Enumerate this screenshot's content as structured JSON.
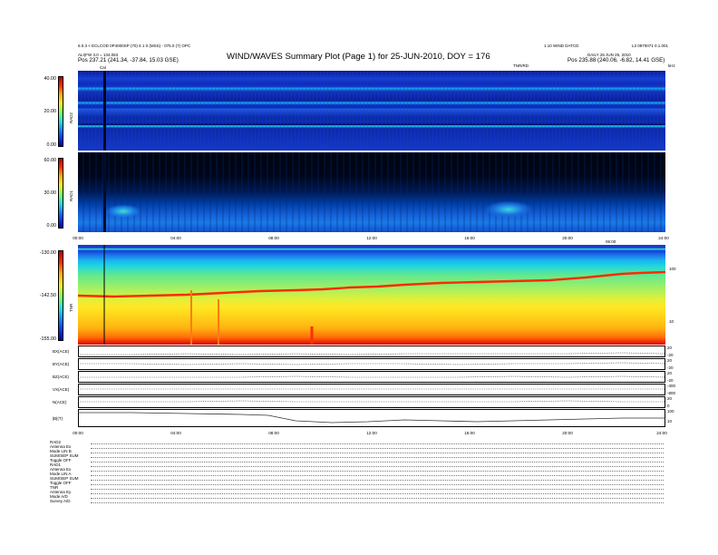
{
  "header": {
    "title": "WIND/WAVES Summary Plot (Page 1) for 25-JUN-2010, DOY = 176",
    "left_line1": "6.0.3 < ECLCOD 0P4000SP (70) 6 1 0 (MSS) - 075.0 (7) OPC",
    "left_line2": "ALI(FW 3.0 = 134.063",
    "left_line3": "Pos    237.21 (241.34, -37.84, 15.03 GSE)",
    "cal_label": "Cal",
    "right_line1": "1.10 WIND DATCD",
    "right_line2": "L3 0970071 0.1.001",
    "right_line3": "DAILY 25 JUN 25, 2010",
    "right_line4": "Pos    235.88 (240.06, -6.82, 14.41 GSE)",
    "tnr_label": "TNR/RD",
    "unit_label": "kHz"
  },
  "colorbar_labels": {
    "rad2": "RAD2",
    "rad1": "RAD1",
    "tnr": "TNR"
  },
  "chart_data": [
    {
      "type": "heatmap",
      "name": "RAD2",
      "yticks": [
        "40.00",
        "20.00",
        "0.00"
      ],
      "ylim": [
        0,
        40
      ]
    },
    {
      "type": "heatmap",
      "name": "RAD1",
      "yticks": [
        "60.00",
        "30.00",
        "0.00"
      ],
      "ylim": [
        0,
        60
      ],
      "xticks": [
        "00:00",
        "04:00",
        "08:00",
        "12:00",
        "16:00",
        "20:00",
        "24:00"
      ],
      "xtick_right_label": "06:00"
    },
    {
      "type": "heatmap",
      "name": "TNR",
      "yticks": [
        "-130.00",
        "-142.50",
        "-155.00"
      ],
      "ylim": [
        -155,
        -130
      ],
      "right_ticks": [
        "100",
        "10"
      ]
    },
    {
      "type": "line",
      "panels": [
        {
          "label": "BX(ACE)",
          "right_ticks": [
            "20",
            "-20"
          ]
        },
        {
          "label": "BY(ACE)",
          "right_ticks": [
            "20",
            "-20"
          ]
        },
        {
          "label": "BZ(ACE)",
          "right_ticks": [
            "20",
            "-20"
          ]
        },
        {
          "label": "VX(ACE)",
          "right_ticks": [
            "-300",
            "-800"
          ]
        },
        {
          "label": "N(ACE)",
          "right_ticks": [
            "20",
            "0"
          ]
        },
        {
          "label": "|B|(T)",
          "right_ticks": [
            "100",
            "10"
          ]
        }
      ],
      "xticks": [
        "00:00",
        "04:00",
        "08:00",
        "12:00",
        "16:00",
        "20:00",
        "24:00"
      ]
    }
  ],
  "footer": [
    {
      "label": "RAD2",
      "value": ""
    },
    {
      "label": "Antenna",
      "value": "Ex"
    },
    {
      "label": "Mode",
      "value": "LIN B"
    },
    {
      "label": "SUM/SEP",
      "value": "SUM"
    },
    {
      "label": "Toggle",
      "value": "OFF"
    },
    {
      "label": "RAD1",
      "value": ""
    },
    {
      "label": "Antenna",
      "value": "Ex"
    },
    {
      "label": "Mode",
      "value": "LIN A"
    },
    {
      "label": "SUM/SEP",
      "value": "SUM"
    },
    {
      "label": "Toggle",
      "value": "OFF"
    },
    {
      "label": "TNR",
      "value": ""
    },
    {
      "label": "Antenna",
      "value": "Ey"
    },
    {
      "label": "Mode",
      "value": "A/D"
    },
    {
      "label": "Survey",
      "value": "A/D"
    }
  ]
}
